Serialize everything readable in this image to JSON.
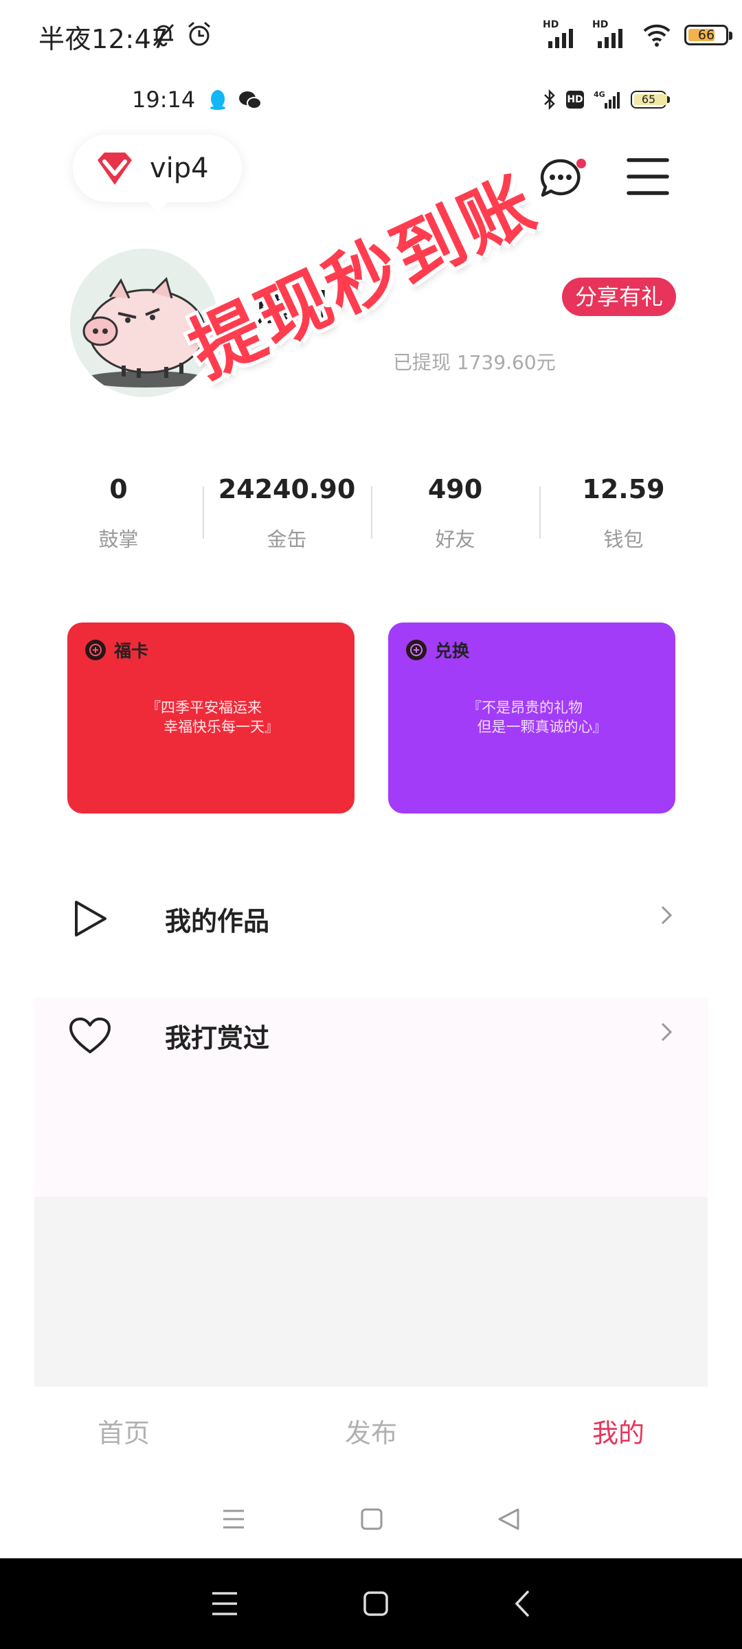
{
  "outer_status": {
    "time": "半夜12:47",
    "battery": "66"
  },
  "inner_status": {
    "time": "19:14",
    "battery": "65"
  },
  "header": {
    "vip_label": "vip4"
  },
  "profile": {
    "name": "熊刚",
    "share_label": "分享有礼",
    "withdrawn": "已提现 1739.60元",
    "stamp": "提现秒到账"
  },
  "stats": [
    {
      "value": "0",
      "label": "鼓掌"
    },
    {
      "value": "24240.90",
      "label": "金缶"
    },
    {
      "value": "490",
      "label": "好友"
    },
    {
      "value": "12.59",
      "label": "钱包"
    }
  ],
  "cards": [
    {
      "title": "福卡",
      "line1": "『四季平安福运来",
      "line2": "幸福快乐每一天』"
    },
    {
      "title": "兑换",
      "line1": "『不是昂贵的礼物",
      "line2": "但是一颗真诚的心』"
    }
  ],
  "menu": [
    {
      "label": "我的作品",
      "icon": "play-icon"
    },
    {
      "label": "我打赏过",
      "icon": "heart-icon"
    }
  ],
  "tabs": [
    "首页",
    "发布",
    "我的"
  ],
  "colors": {
    "accent": "#e8345a",
    "card_red": "#ef2b3a",
    "card_purple": "#a23cf8"
  }
}
